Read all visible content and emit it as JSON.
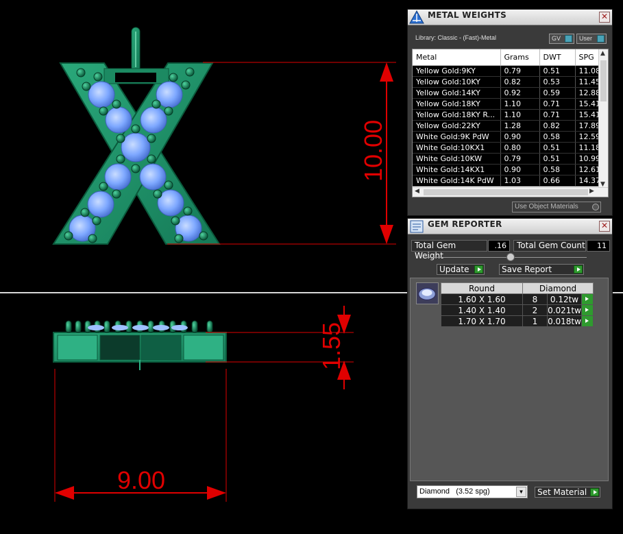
{
  "dimensions": {
    "height": "10.00",
    "width": "9.00",
    "depth": "1.55"
  },
  "colors": {
    "metal": "#1f8f68",
    "dimension": "#e00000",
    "gem": "#7ea8ff"
  },
  "metal_weights": {
    "title": "METAL WEIGHTS",
    "library": "Library: Classic - (Fast)-Metal",
    "gv_label": "GV",
    "user_label": "User",
    "columns": [
      "Metal",
      "Grams",
      "DWT",
      "SPG"
    ],
    "rows": [
      [
        "Yellow Gold:9KY",
        "0.79",
        "0.51",
        "11.08"
      ],
      [
        "Yellow Gold:10KY",
        "0.82",
        "0.53",
        "11.45"
      ],
      [
        "Yellow Gold:14KY",
        "0.92",
        "0.59",
        "12.88"
      ],
      [
        "Yellow Gold:18KY",
        "1.10",
        "0.71",
        "15.41"
      ],
      [
        "Yellow Gold:18KY R...",
        "1.10",
        "0.71",
        "15.41"
      ],
      [
        "Yellow Gold:22KY",
        "1.28",
        "0.82",
        "17.89"
      ],
      [
        "White Gold:9K PdW",
        "0.90",
        "0.58",
        "12.59"
      ],
      [
        "White Gold:10KX1",
        "0.80",
        "0.51",
        "11.18"
      ],
      [
        "White Gold:10KW",
        "0.79",
        "0.51",
        "10.99"
      ],
      [
        "White Gold:14KX1",
        "0.90",
        "0.58",
        "12.61"
      ],
      [
        "White Gold:14K PdW",
        "1.03",
        "0.66",
        "14.37"
      ]
    ],
    "use_object_materials": "Use Object Materials"
  },
  "gem_reporter": {
    "title": "GEM REPORTER",
    "total_weight_label": "Total Gem Weight",
    "total_weight_value": ".16",
    "total_count_label": "Total Gem Count",
    "total_count_value": "11",
    "update_label": "Update",
    "save_report_label": "Save Report",
    "table_headers": [
      "Round",
      "Diamond"
    ],
    "rows": [
      [
        "1.60 X 1.60",
        "8",
        "0.12tw"
      ],
      [
        "1.40 X 1.40",
        "2",
        "0.021tw"
      ],
      [
        "1.70 X 1.70",
        "1",
        "0.018tw"
      ]
    ],
    "material_selected": "Diamond   (3.52 spg)",
    "set_material_label": "Set Material"
  }
}
